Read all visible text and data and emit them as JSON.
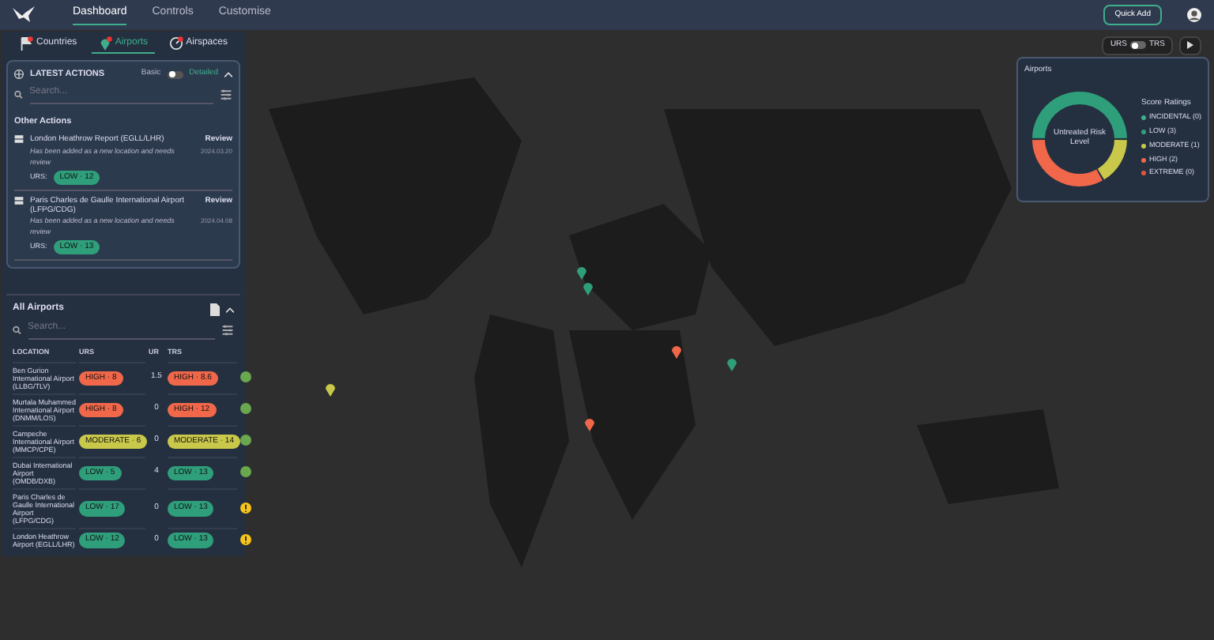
{
  "nav": {
    "items": [
      {
        "label": "Dashboard",
        "selected": true
      },
      {
        "label": "Controls",
        "selected": false
      },
      {
        "label": "Customise",
        "selected": false
      }
    ],
    "quick_add": "Quick Add"
  },
  "tabs": [
    {
      "label": "Countries",
      "selected": false,
      "kind": "flag"
    },
    {
      "label": "Airports",
      "selected": true,
      "kind": "pin"
    },
    {
      "label": "Airspaces",
      "selected": false,
      "kind": "radar"
    }
  ],
  "latest_actions": {
    "title": "LATEST ACTIONS",
    "toggle_left": "Basic",
    "toggle_right": "Detailed",
    "detailed": true,
    "search_placeholder": "Search...",
    "other_actions": "Other Actions",
    "items": [
      {
        "title": "London Heathrow Report (EGLL/LHR)",
        "note": "Has been added as a new location and needs review",
        "status": "Review",
        "date": "2024.03.20",
        "score_label": "URS:",
        "badge": {
          "text": "LOW · 12",
          "color": "#2f9e7a"
        }
      },
      {
        "title": "Paris Charles de Gaulle International Airport (LFPG/CDG)",
        "note": "Has been added as a new location and needs review",
        "status": "Review",
        "date": "2024.04.08",
        "score_label": "URS:",
        "badge": {
          "text": "LOW · 13",
          "color": "#2f9e7a"
        }
      }
    ]
  },
  "all_airports": {
    "title": "All Airports",
    "search_placeholder": "Search...",
    "columns": [
      "LOCATION",
      "URS",
      "UR",
      "TRS"
    ],
    "rows": [
      {
        "location": "Ben Gurion International Airport (LLBG/TLV)",
        "urs": {
          "text": "HIGH · 8",
          "color": "#f0674a"
        },
        "ur": "1.5",
        "trs": {
          "text": "HIGH · 8.6",
          "color": "#f0674a"
        },
        "warning": false
      },
      {
        "location": "Murtala Muhammed International Airport (DNMM/LOS)",
        "urs": {
          "text": "HIGH · 8",
          "color": "#f0674a"
        },
        "ur": "0",
        "trs": {
          "text": "HIGH · 12",
          "color": "#f0674a"
        },
        "warning": false
      },
      {
        "location": "Campeche International Airport (MMCP/CPE)",
        "urs": {
          "text": "MODERATE · 6",
          "color": "#c9c84a"
        },
        "ur": "0",
        "trs": {
          "text": "MODERATE · 14",
          "color": "#c9c84a"
        },
        "warning": false
      },
      {
        "location": "Dubai International Airport (OMDB/DXB)",
        "urs": {
          "text": "LOW · 5",
          "color": "#2f9e7a"
        },
        "ur": "4",
        "trs": {
          "text": "LOW · 13",
          "color": "#2f9e7a"
        },
        "warning": false
      },
      {
        "location": "Paris Charles de Gaulle International Airport (LFPG/CDG)",
        "urs": {
          "text": "LOW · 17",
          "color": "#2f9e7a"
        },
        "ur": "0",
        "trs": {
          "text": "LOW · 13",
          "color": "#2f9e7a"
        },
        "warning": true
      },
      {
        "location": "London Heathrow Airport (EGLL/LHR)",
        "urs": {
          "text": "LOW · 12",
          "color": "#2f9e7a"
        },
        "ur": "0",
        "trs": {
          "text": "LOW · 13",
          "color": "#2f9e7a"
        },
        "warning": true
      }
    ]
  },
  "score_toggle": {
    "left": "URS",
    "right": "TRS",
    "trs": false
  },
  "map_markers": [
    {
      "color": "#c9c84a"
    },
    {
      "color": "#2f9e7a"
    },
    {
      "color": "#2f9e7a"
    },
    {
      "color": "#f0674a"
    },
    {
      "color": "#2f9e7a"
    },
    {
      "color": "#f0674a"
    }
  ],
  "risk_card": {
    "title": "Airports",
    "center_label": "Untreated Risk Level",
    "legend_title": "Score Ratings",
    "chart_data": {
      "type": "donut",
      "categories": [
        "INCIDENTAL (0)",
        "LOW (3)",
        "MODERATE (1)",
        "HIGH (2)",
        "EXTREME (0)"
      ],
      "values": [
        0,
        3,
        1,
        2,
        0
      ],
      "colors": [
        "#3fae8c",
        "#2f9e7a",
        "#c9c84a",
        "#f0674a",
        "#e2553a"
      ]
    }
  }
}
